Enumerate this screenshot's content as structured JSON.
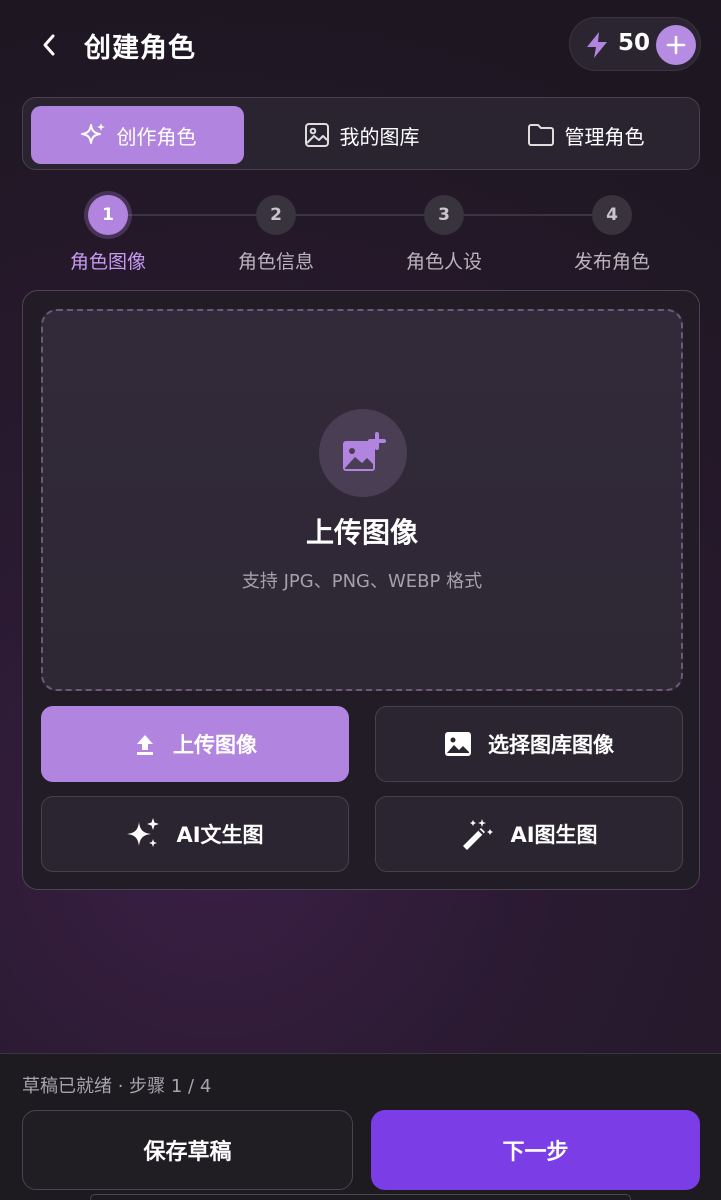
{
  "header": {
    "title": "创建角色",
    "back_icon": "chevron-left-icon",
    "credits": "50",
    "credits_icon": "bolt-icon",
    "add_icon": "plus-icon"
  },
  "tabs": [
    {
      "label": "创作角色",
      "icon": "sparkles-icon",
      "active": true
    },
    {
      "label": "我的图库",
      "icon": "image-icon",
      "active": false
    },
    {
      "label": "管理角色",
      "icon": "folder-icon",
      "active": false
    }
  ],
  "steps": [
    {
      "number": "1",
      "label": "角色图像",
      "active": true
    },
    {
      "number": "2",
      "label": "角色信息",
      "active": false
    },
    {
      "number": "3",
      "label": "角色人设",
      "active": false
    },
    {
      "number": "4",
      "label": "发布角色",
      "active": false
    }
  ],
  "upload": {
    "title": "上传图像",
    "subtitle": "支持 JPG、PNG、WEBP 格式",
    "icon": "image-add-icon"
  },
  "actions": {
    "upload": {
      "label": "上传图像",
      "icon": "upload-icon"
    },
    "gallery": {
      "label": "选择图库图像",
      "icon": "image-icon"
    },
    "text_to_image": {
      "label": "AI文生图",
      "icon": "sparkles-icon"
    },
    "image_to_image": {
      "label": "AI图生图",
      "icon": "magic-wand-icon"
    }
  },
  "footer": {
    "status": "草稿已就绪 · 步骤 1 / 4",
    "save_label": "保存草稿",
    "next_label": "下一步"
  },
  "colors": {
    "accent": "#b184e0",
    "primary_button": "#7b3ee6",
    "background": "#221a26"
  }
}
